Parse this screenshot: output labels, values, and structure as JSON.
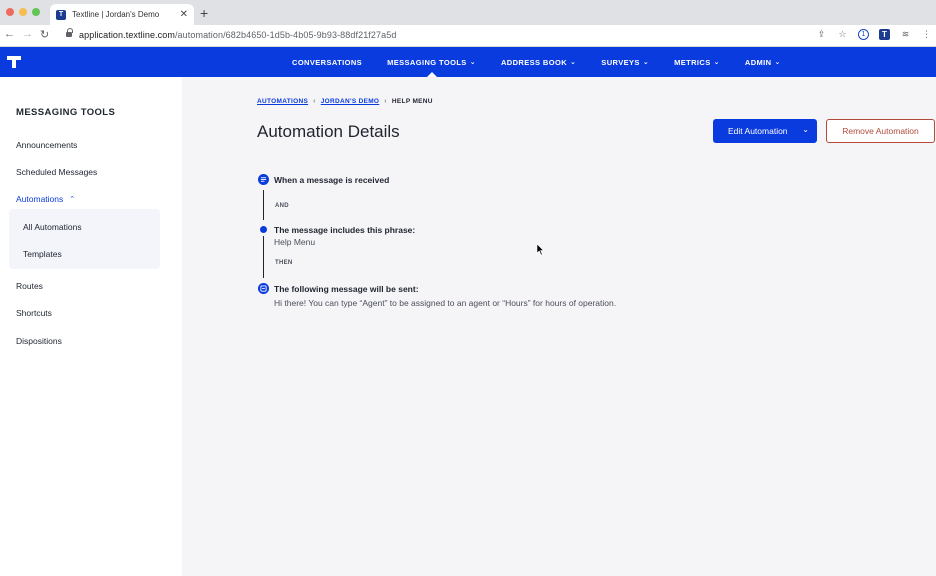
{
  "browser": {
    "tab_title": "Textline | Jordan's Demo",
    "url_host": "application.textline.com",
    "url_path": "/automation/682b4650-1d5b-4b05-9b93-88df21f27a5d"
  },
  "nav": {
    "items": [
      {
        "label": "CONVERSATIONS",
        "has_menu": false
      },
      {
        "label": "MESSAGING TOOLS",
        "has_menu": true
      },
      {
        "label": "ADDRESS BOOK",
        "has_menu": true
      },
      {
        "label": "SURVEYS",
        "has_menu": true
      },
      {
        "label": "METRICS",
        "has_menu": true
      },
      {
        "label": "ADMIN",
        "has_menu": true
      }
    ]
  },
  "sidebar": {
    "title": "MESSAGING TOOLS",
    "items": {
      "announcements": "Announcements",
      "scheduled": "Scheduled Messages",
      "automations": "Automations",
      "all_automations": "All Automations",
      "templates": "Templates",
      "routes": "Routes",
      "shortcuts": "Shortcuts",
      "dispositions": "Dispositions"
    }
  },
  "breadcrumb": {
    "automations": "AUTOMATIONS",
    "demo": "JORDAN'S DEMO",
    "current": "HELP MENU"
  },
  "page": {
    "title": "Automation Details",
    "edit_label": "Edit Automation",
    "remove_label": "Remove Automation"
  },
  "steps": {
    "trigger": "When a message is received",
    "and": "AND",
    "condition_title": "The message includes this phrase:",
    "condition_value": "Help Menu",
    "then": "THEN",
    "action_title": "The following message will be sent:",
    "action_value": "Hi there! You can type “Agent” to be assigned to an agent or “Hours” for hours of operation."
  },
  "colors": {
    "brand_blue": "#0a3bde",
    "remove_red": "#b24a3a",
    "main_bg": "#f5f5f7"
  }
}
